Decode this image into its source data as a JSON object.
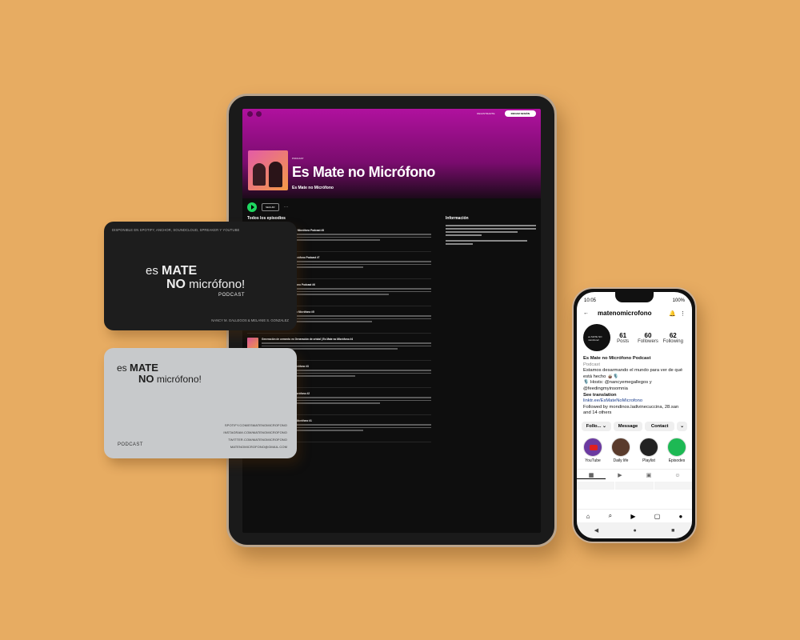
{
  "spotify": {
    "upgrade": "REGISTRARTE",
    "login": "INICIAR SESIÓN",
    "type": "PODCAST",
    "title": "Es Mate no Micrófono",
    "author": "Es Mate no Micrófono",
    "follow": "SEGUIR",
    "more": "···",
    "episodes_heading": "Todos los episodios",
    "info_heading": "Información",
    "episodes": [
      {
        "title": "rominos de vida | Es Mate no Micrófono Podcast #8"
      },
      {
        "title": "entrenzado? | Es Mate no Micrófono Podcast #7"
      },
      {
        "title": "·Mucho? | Es Mate no Micrófono Podcast #6"
      },
      {
        "title": "es el de mi vida? | Es Mate no Micrófono #5"
      },
      {
        "title": "Generación de cemento vs Generación de cristal | Es Mate no Micrófono #4"
      },
      {
        "title": "es la mujer? | Es Mate no Micrófono #3"
      },
      {
        "title": "Bajo Tensión | Es Mate no Micrófono #2"
      },
      {
        "title": "ejor relaciones | Es Mate no Micrófono #1"
      }
    ],
    "last_meta": "ago 2022 · 24 min"
  },
  "card_black": {
    "top_line": "DISPONIBLE EN SPOTIFY, ANCHOR, SOUNDCLOUD, SPREAKER Y YOUTUBE",
    "logo_es": "es",
    "logo_mate": "MATE",
    "logo_no": "NO",
    "logo_mic": "micrófono!",
    "logo_podcast": "PODCAST",
    "names": "NANCY M. GALLEGOS & MELANIE S. GONZALEZ"
  },
  "card_grey": {
    "logo_es": "es",
    "logo_mate": "MATE",
    "logo_no": "NO",
    "logo_mic": "micrófono!",
    "links": [
      "SPOTIFY.COM/ESMATENOMICROFONO",
      "INSTAGRAM.COM/MATENOMICROFONO",
      "TWITTER.COM/MATENOMICROFONO",
      "MATENOMICROFONO@GMAIL.COM"
    ],
    "podcast": "PODCAST"
  },
  "instagram": {
    "time": "10:05",
    "battery": "100%",
    "username": "matenomicrofono",
    "avatar_text": "es MATE NO micrófono!",
    "posts_n": "61",
    "posts_l": "Posts",
    "followers_n": "60",
    "followers_l": "Followers",
    "following_n": "62",
    "following_l": "Following",
    "bio_name": "Es Mate no Micrófono Podcast",
    "bio_category": "Podcast",
    "bio_line1": "Estamos desarmando el mundo para ver de qué está hecho 🧉🎙️",
    "bio_line2": "🎙️ Hosts: @nancyemegallegos y @feedingmyinsomnia",
    "see_translation": "See translation",
    "link": "linktr.ee/EsMateNoMicrofono",
    "followed_by": "Followed by mondinos.ladivinecuccina, 28.san and 14 others",
    "btn_follow": "Follo... ⌄",
    "btn_message": "Message",
    "btn_contact": "Contact",
    "btn_more": "⌄",
    "highlights": [
      "YouTube",
      "Daily life",
      "Playlist",
      "Episodes"
    ]
  },
  "colors": {
    "background": "#e7ac62",
    "spotify_gradient": "#b0119e",
    "spotify_green": "#1ed760"
  }
}
